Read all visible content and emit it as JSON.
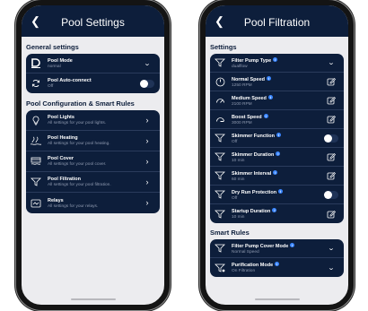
{
  "left_screen": {
    "header": {
      "back_icon": "chevron-left-icon",
      "title": "Pool Settings"
    },
    "general_settings": {
      "section_title": "General settings",
      "items": [
        {
          "label": "Pool Mode",
          "value": "normal",
          "icon": "pool-mode-logo-icon",
          "control": "chevron-down"
        },
        {
          "label": "Pool Auto-connect",
          "value": "Off",
          "icon": "sync-icon",
          "control": "toggle",
          "toggle_on": false
        }
      ]
    },
    "pool_configuration": {
      "section_title": "Pool Configuration & Smart Rules",
      "items": [
        {
          "label": "Pool Lights",
          "value": "All settings for your pool lights.",
          "icon": "lightbulb-icon"
        },
        {
          "label": "Pool Heating",
          "value": "All settings for your pool heating.",
          "icon": "heating-icon"
        },
        {
          "label": "Pool Cover",
          "value": "All settings for your pool cover.",
          "icon": "pool-cover-icon"
        },
        {
          "label": "Pool Filtration",
          "value": "All settings for your pool filtration.",
          "icon": "filter-icon"
        },
        {
          "label": "Relays",
          "value": "All settings for your relays.",
          "icon": "relay-icon"
        }
      ]
    }
  },
  "right_screen": {
    "header": {
      "back_icon": "chevron-left-icon",
      "title": "Pool Filtration"
    },
    "settings": {
      "section_title": "Settings",
      "items": [
        {
          "label": "Filter Pump Type",
          "value": "dualflow",
          "icon": "filter-icon",
          "control": "chevron-down"
        },
        {
          "label": "Normal Speed",
          "value": "1250 RPM",
          "icon": "gauge-low-icon",
          "control": "edit"
        },
        {
          "label": "Medium Speed",
          "value": "2100 RPM",
          "icon": "gauge-medium-icon",
          "control": "edit"
        },
        {
          "label": "Boost Speed",
          "value": "3000 RPM",
          "icon": "gauge-high-icon",
          "control": "edit"
        },
        {
          "label": "Skimmer Function",
          "value": "Off",
          "icon": "filter-icon",
          "control": "toggle",
          "toggle_on": false
        },
        {
          "label": "Skimmer Duration",
          "value": "10 min",
          "icon": "filter-icon",
          "control": "edit"
        },
        {
          "label": "Skimmer Interval",
          "value": "60 min",
          "icon": "filter-icon",
          "control": "edit"
        },
        {
          "label": "Dry Run Protection",
          "value": "Off",
          "icon": "filter-icon",
          "control": "toggle",
          "toggle_on": false
        },
        {
          "label": "Startup Duration",
          "value": "10 min",
          "icon": "filter-icon",
          "control": "edit"
        }
      ]
    },
    "smart_rules": {
      "section_title": "Smart Rules",
      "items": [
        {
          "label": "Filter Pump Cover Mode",
          "value": "Normal Speed",
          "icon": "filter-icon",
          "control": "chevron-down"
        },
        {
          "label": "Purification Mode",
          "value": "On Filtration",
          "icon": "purification-icon",
          "control": "chevron-down"
        }
      ]
    }
  },
  "colors": {
    "header": "#0d1e3b",
    "card": "#0d1e3b",
    "background": "#ececef",
    "accent": "#3a86ff"
  }
}
